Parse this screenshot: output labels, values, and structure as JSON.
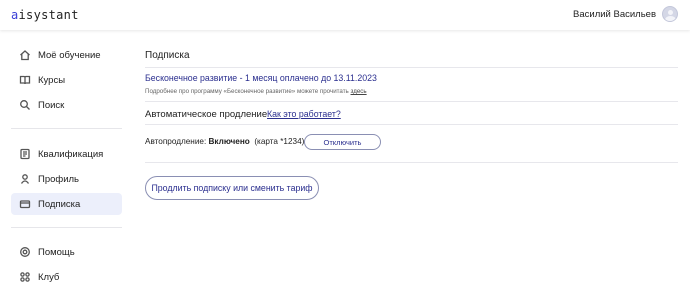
{
  "header": {
    "logo_accent": "a",
    "logo_rest": "isystant",
    "user_name": "Василий Васильев"
  },
  "sidebar": {
    "items": [
      {
        "label": "Моё обучение",
        "icon": "home-icon"
      },
      {
        "label": "Курсы",
        "icon": "book-icon"
      },
      {
        "label": "Поиск",
        "icon": "search-icon"
      },
      {
        "label": "Квалификация",
        "icon": "certificate-icon"
      },
      {
        "label": "Профиль",
        "icon": "person-icon"
      },
      {
        "label": "Подписка",
        "icon": "card-icon",
        "active": true
      },
      {
        "label": "Помощь",
        "icon": "help-icon"
      },
      {
        "label": "Клуб",
        "icon": "club-icon"
      }
    ]
  },
  "main": {
    "title": "Подписка",
    "plan": {
      "title": "Бесконечное развитие - 1 месяц оплачено до 13.11.2023",
      "desc": "Подробнее про программу «Бесконечное развитие» можете прочитать",
      "desc_link": "здесь"
    },
    "auto_renew": {
      "title": "Автоматическое продление",
      "how_link": "Как это работает?",
      "status_label": "Автопродление:",
      "status_value": "Включено",
      "card": "(карта *1234)",
      "disable_button": "Отключить"
    },
    "extend_button": "Продлить подписку или сменить тариф"
  },
  "colors": {
    "accent": "#3a3fd6",
    "link": "#2b2f8f",
    "active_bg": "#eceffb"
  }
}
